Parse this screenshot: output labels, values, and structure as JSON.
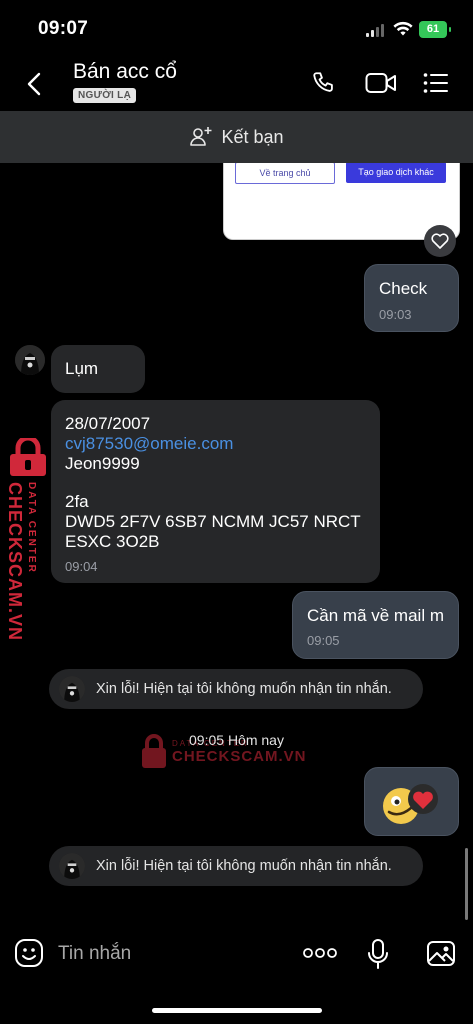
{
  "status_bar": {
    "time": "09:07",
    "battery": "61"
  },
  "header": {
    "title": "Bán acc cổ",
    "badge": "NGƯỜI LẠ"
  },
  "add_friend": {
    "label": "Kết bạn"
  },
  "previous_card": {
    "left_button": "Về trang chủ",
    "right_button": "Tạo giao dịch khác"
  },
  "messages": [
    {
      "direction": "out",
      "text": "Check",
      "time": "09:03"
    },
    {
      "direction": "in",
      "text": "Lụm"
    },
    {
      "direction": "in",
      "email": "cvj87530@omeie.com",
      "line1": "28/07/2007",
      "line2": "Jeon9999",
      "line3": "2fa",
      "line4": "DWD5 2F7V 6SB7 NCMM JC57 NRCT",
      "line5": "ESXC 3O2B",
      "time": "09:04"
    },
    {
      "direction": "out",
      "text": "Cần mã về mail m",
      "time": "09:05"
    },
    {
      "direction": "system",
      "text": "Xin lỗi! Hiện tại tôi không muốn nhận tin nhắn."
    },
    {
      "direction": "system",
      "text": "Xin lỗi! Hiện tại tôi không muốn nhận tin nhắn."
    }
  ],
  "date_separator": "09:05 Hôm nay",
  "watermark": {
    "line1": "DATA CENTER",
    "line2": "CHECKSCAM.VN"
  },
  "composer": {
    "placeholder": "Tin nhắn"
  },
  "colors": {
    "link": "#4a90e2",
    "watermark": "#d0283a",
    "battery": "#34c759"
  }
}
